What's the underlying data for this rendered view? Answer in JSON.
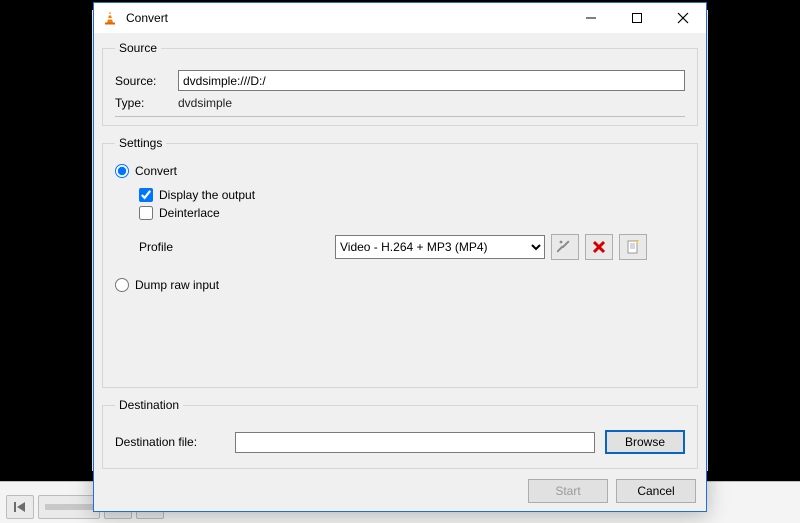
{
  "window": {
    "title": "Convert"
  },
  "source": {
    "group_label": "Source",
    "source_label": "Source:",
    "source_value": "dvdsimple:///D:/",
    "type_label": "Type:",
    "type_value": "dvdsimple"
  },
  "settings": {
    "group_label": "Settings",
    "convert_label": "Convert",
    "display_output_label": "Display the output",
    "deinterlace_label": "Deinterlace",
    "profile_label": "Profile",
    "profile_value": "Video - H.264 + MP3 (MP4)",
    "dump_label": "Dump raw input"
  },
  "destination": {
    "group_label": "Destination",
    "file_label": "Destination file:",
    "file_value": "",
    "browse_label": "Browse"
  },
  "actions": {
    "start_label": "Start",
    "cancel_label": "Cancel"
  },
  "icons": {
    "wrench": "wrench-icon",
    "delete": "delete-icon",
    "new_profile": "new-profile-icon"
  }
}
